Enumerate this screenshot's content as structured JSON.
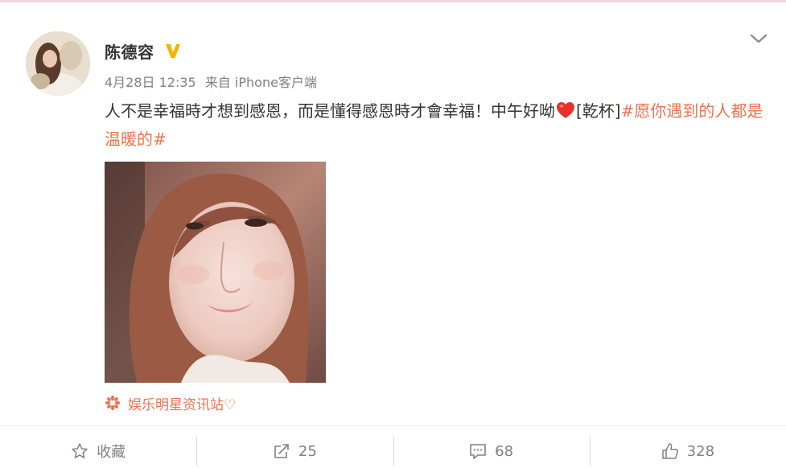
{
  "post": {
    "author": "陈德容",
    "meta": {
      "date": "4月28日 12:35",
      "source": "来自 iPhone客户端"
    },
    "text_before_heart": "人不是幸福時才想到感恩，而是懂得感恩時才會幸福！中午好呦",
    "text_after_heart": "[乾杯]",
    "hashtag": "#愿你遇到的人都是温暖的#",
    "source_label": "娱乐明星资讯站♡"
  },
  "actions": {
    "favorite_label": "收藏",
    "repost_count": "25",
    "comment_count": "68",
    "like_count": "328"
  },
  "colors": {
    "hashtag": "#eb7350",
    "verified": "#f6b400",
    "muted": "#808080"
  },
  "icons": {
    "verified": "verified-v-icon",
    "menu": "chevron-down-icon",
    "heart": "heart-emoji",
    "source": "flower-icon",
    "favorite": "star-icon",
    "repost": "repost-icon",
    "comment": "comment-icon",
    "like": "thumbs-up-icon"
  }
}
